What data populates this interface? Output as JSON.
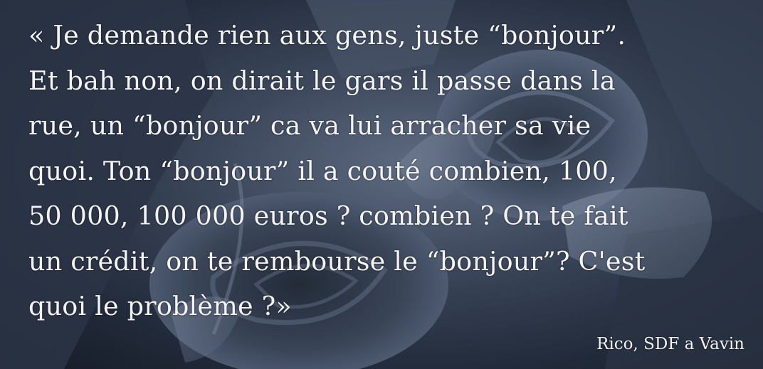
{
  "quote": {
    "lines": [
      "« Je demande rien aux gens, juste “bonjour”.",
      "Et bah non, on dirait le gars il passe dans la",
      "rue, un “bonjour” ca va lui arracher sa vie",
      "quoi. Ton “bonjour” il a couté combien, 100,",
      "50 000, 100 000 euros ? combien ? On te fait",
      "un crédit, on te rembourse le “bonjour”? C'est",
      "quoi le problème ?»"
    ]
  },
  "attribution": "Rico, SDF a Vavin"
}
